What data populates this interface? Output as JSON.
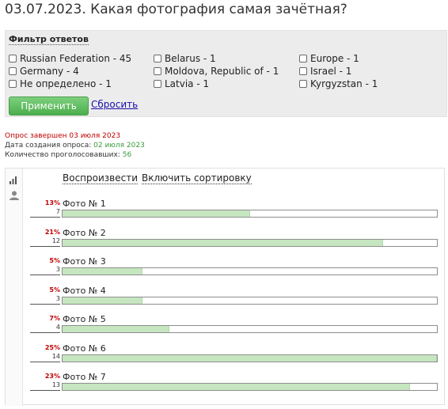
{
  "title": "03.07.2023. Какая фотография самая зачётная?",
  "filter": {
    "title": "Фильтр ответов",
    "options": [
      {
        "label": "Russian Federation - 45"
      },
      {
        "label": "Belarus - 1"
      },
      {
        "label": "Europe - 1"
      },
      {
        "label": "Germany - 4"
      },
      {
        "label": "Moldova, Republic of - 1"
      },
      {
        "label": "Israel - 1"
      },
      {
        "label": "Не определено - 1"
      },
      {
        "label": "Latvia - 1"
      },
      {
        "label": "Kyrgyzstan - 1"
      }
    ],
    "apply_label": "Применить",
    "reset_label": "Сбросить"
  },
  "poll_info": {
    "closed_label": "Опрос завершен",
    "closed_date": "03 июля 2023",
    "created_label": "Дата создания опроса:",
    "created_date": "02 июля 2023",
    "votes_label": "Количество проголосовавших:",
    "votes_count": "56"
  },
  "toolbar": {
    "play_label": "Воспроизвести",
    "sort_label": "Включить сортировку"
  },
  "results": [
    {
      "label": "Фото № 1",
      "percent": "13%",
      "count": "7",
      "fill": 0.5
    },
    {
      "label": "Фото № 2",
      "percent": "21%",
      "count": "12",
      "fill": 0.857
    },
    {
      "label": "Фото № 3",
      "percent": "5%",
      "count": "3",
      "fill": 0.214
    },
    {
      "label": "Фото № 4",
      "percent": "5%",
      "count": "3",
      "fill": 0.214
    },
    {
      "label": "Фото № 5",
      "percent": "7%",
      "count": "4",
      "fill": 0.286
    },
    {
      "label": "Фото № 6",
      "percent": "25%",
      "count": "14",
      "fill": 1.0
    },
    {
      "label": "Фото № 7",
      "percent": "23%",
      "count": "13",
      "fill": 0.929
    }
  ],
  "colors": {
    "accent_green": "#5cb85c",
    "bar_fill": "#c6e6c0",
    "percent_red": "#c00000",
    "link_blue": "#1a0dab"
  },
  "icons": [
    "bar-chart-icon",
    "user-icon"
  ]
}
